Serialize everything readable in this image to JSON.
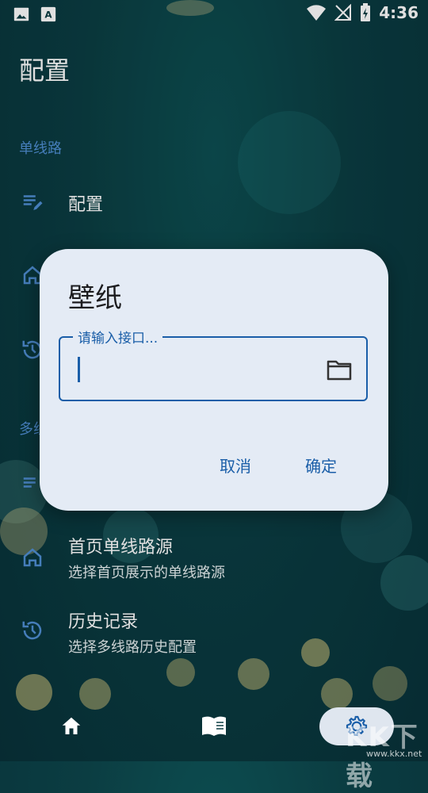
{
  "statusbar": {
    "time": "4:36"
  },
  "page": {
    "title": "配置"
  },
  "sections": {
    "single_line_label": "单线路",
    "multi_line_label_partial": "多线"
  },
  "rows": {
    "config_title": "配置",
    "home_source_title": "首页单线路源",
    "home_source_sub": "选择首页展示的单线路源",
    "history_title": "历史记录",
    "history_sub": "选择多线路历史配置"
  },
  "dialog": {
    "title": "壁纸",
    "field_label": "请输入接口...",
    "field_value": "",
    "cancel": "取消",
    "confirm": "确定"
  },
  "bottomnav": {
    "items": [
      {
        "icon": "home-icon",
        "active": false
      },
      {
        "icon": "book-icon",
        "active": false
      },
      {
        "icon": "gear-icon",
        "active": true
      }
    ]
  },
  "watermark": {
    "text": "KK下载",
    "url": "www.kkx.net"
  }
}
